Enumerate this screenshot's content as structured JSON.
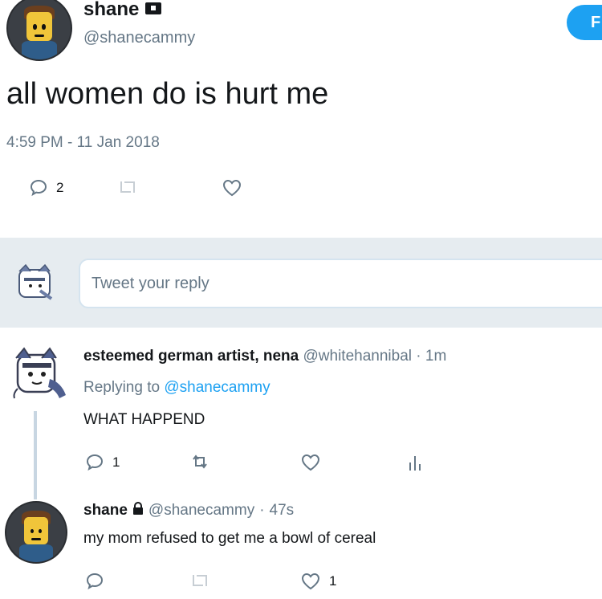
{
  "main_tweet": {
    "display_name": "shane",
    "handle": "@shanecammy",
    "text": "all women do is hurt me",
    "timestamp": "4:59 PM - 11 Jan 2018",
    "reply_count": "2",
    "follow_button_label": "F",
    "verified_icon": "lock-icon"
  },
  "reply_box": {
    "placeholder": "Tweet your reply"
  },
  "reply_1": {
    "display_name": "esteemed german artist, nena",
    "handle": "@whitehannibal",
    "separator": "·",
    "time": "1m",
    "replying_label": "Replying to",
    "replying_to": "@shanecammy",
    "text": "WHAT HAPPEND",
    "reply_count": "1"
  },
  "reply_2": {
    "display_name": "shane",
    "handle": "@shanecammy",
    "separator": "·",
    "time": "47s",
    "text": "my mom refused to get me a bowl of cereal",
    "like_count": "1"
  },
  "colors": {
    "accent": "#1da1f2",
    "text_gray": "#657786",
    "divider": "#e6ecf0"
  }
}
